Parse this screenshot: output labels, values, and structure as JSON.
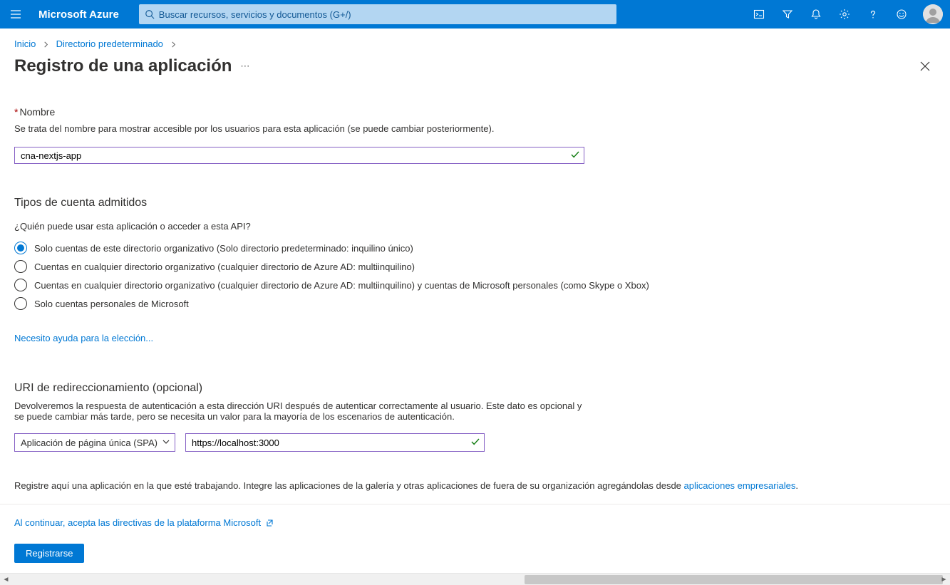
{
  "header": {
    "brand": "Microsoft Azure",
    "search_placeholder": "Buscar recursos, servicios y documentos (G+/)"
  },
  "breadcrumb": {
    "home": "Inicio",
    "dir": "Directorio predeterminado"
  },
  "page": {
    "title": "Registro de una aplicación"
  },
  "name_section": {
    "label": "Nombre",
    "desc": "Se trata del nombre para mostrar accesible por los usuarios para esta aplicación (se puede cambiar posteriormente).",
    "value": "cna-nextjs-app"
  },
  "accounts": {
    "heading": "Tipos de cuenta admitidos",
    "question": "¿Quién puede usar esta aplicación o acceder a esta API?",
    "options": [
      "Solo cuentas de este directorio organizativo (Solo directorio predeterminado: inquilino único)",
      "Cuentas en cualquier directorio organizativo (cualquier directorio de Azure AD: multiinquilino)",
      "Cuentas en cualquier directorio organizativo (cualquier directorio de Azure AD: multiinquilino) y cuentas de Microsoft personales (como Skype o Xbox)",
      "Solo cuentas personales de Microsoft"
    ],
    "help": "Necesito ayuda para la elección..."
  },
  "redirect": {
    "heading": "URI de redireccionamiento (opcional)",
    "desc": "Devolveremos la respuesta de autenticación a esta dirección URI después de autenticar correctamente al usuario. Este dato es opcional y se puede cambiar más tarde, pero se necesita un valor para la mayoría de los escenarios de autenticación.",
    "platform": "Aplicación de página única (SPA)",
    "uri": "https://localhost:3000"
  },
  "note": {
    "prefix": "Registre aquí una aplicación en la que esté trabajando. Integre las aplicaciones de la galería y otras aplicaciones de fuera de su organización agregándolas desde ",
    "link": "aplicaciones empresariales",
    "suffix": "."
  },
  "footer": {
    "policies": "Al continuar, acepta las directivas de la plataforma Microsoft",
    "submit": "Registrarse"
  }
}
